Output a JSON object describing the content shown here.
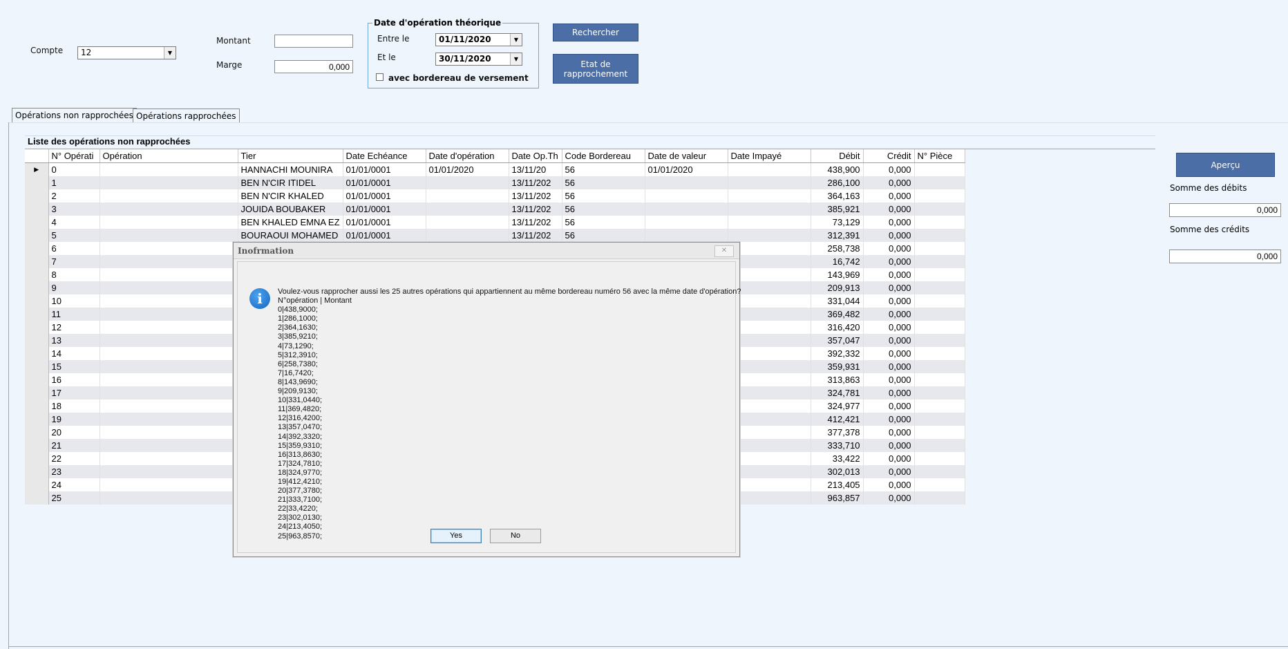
{
  "filters": {
    "compte_label": "Compte",
    "compte_value": "12",
    "montant_label": "Montant",
    "montant_value": "",
    "marge_label": "Marge",
    "marge_value": "0,000",
    "date_group_title": "Date d'opération théorique",
    "entre_label": "Entre le",
    "entre_value": "01/11/2020",
    "et_label": "Et le",
    "et_value": "30/11/2020",
    "bordereau_checkbox_label": "avec bordereau de versement",
    "bordereau_checked": false
  },
  "buttons": {
    "rechercher": "Rechercher",
    "etat_line1": "Etat de",
    "etat_line2": "rapprochement",
    "apercu": "Aperçu"
  },
  "tabs": [
    {
      "label": "Opérations non rapprochées",
      "active": true
    },
    {
      "label": "Opérations rapprochées",
      "active": false
    }
  ],
  "list_title": "Liste des opérations non rapprochées",
  "columns": [
    "N° Opérati",
    "Opération",
    "Tier",
    "Date Echéance",
    "Date d'opération",
    "Date Op.Th",
    "Code Bordereau",
    "Date de valeur",
    "Date Impayé",
    "Débit",
    "Crédit",
    "N° Pièce"
  ],
  "rows": [
    [
      "0",
      "",
      "HANNACHI MOUNIRA",
      "01/01/0001",
      "01/01/2020",
      "13/11/20",
      "56",
      "01/01/2020",
      "",
      "438,900",
      "0,000",
      ""
    ],
    [
      "1",
      "",
      "BEN N'CIR ITIDEL",
      "01/01/0001",
      "",
      "13/11/202",
      "56",
      "",
      "",
      "286,100",
      "0,000",
      ""
    ],
    [
      "2",
      "",
      "BEN N'CIR KHALED",
      "01/01/0001",
      "",
      "13/11/202",
      "56",
      "",
      "",
      "364,163",
      "0,000",
      ""
    ],
    [
      "3",
      "",
      "JOUIDA BOUBAKER",
      "01/01/0001",
      "",
      "13/11/202",
      "56",
      "",
      "",
      "385,921",
      "0,000",
      ""
    ],
    [
      "4",
      "",
      "BEN KHALED EMNA EZ",
      "01/01/0001",
      "",
      "13/11/202",
      "56",
      "",
      "",
      "73,129",
      "0,000",
      ""
    ],
    [
      "5",
      "",
      "BOURAOUI MOHAMED",
      "01/01/0001",
      "",
      "13/11/202",
      "56",
      "",
      "",
      "312,391",
      "0,000",
      ""
    ],
    [
      "6",
      "",
      "",
      "",
      "",
      "",
      "",
      "",
      "",
      "258,738",
      "0,000",
      ""
    ],
    [
      "7",
      "",
      "",
      "",
      "",
      "",
      "",
      "",
      "",
      "16,742",
      "0,000",
      ""
    ],
    [
      "8",
      "",
      "",
      "",
      "",
      "",
      "",
      "",
      "",
      "143,969",
      "0,000",
      ""
    ],
    [
      "9",
      "",
      "",
      "",
      "",
      "",
      "",
      "",
      "",
      "209,913",
      "0,000",
      ""
    ],
    [
      "10",
      "",
      "",
      "",
      "",
      "",
      "",
      "",
      "",
      "331,044",
      "0,000",
      ""
    ],
    [
      "11",
      "",
      "",
      "",
      "",
      "",
      "",
      "",
      "",
      "369,482",
      "0,000",
      ""
    ],
    [
      "12",
      "",
      "",
      "",
      "",
      "",
      "",
      "",
      "",
      "316,420",
      "0,000",
      ""
    ],
    [
      "13",
      "",
      "",
      "",
      "",
      "",
      "",
      "",
      "",
      "357,047",
      "0,000",
      ""
    ],
    [
      "14",
      "",
      "",
      "",
      "",
      "",
      "",
      "",
      "",
      "392,332",
      "0,000",
      ""
    ],
    [
      "15",
      "",
      "",
      "",
      "",
      "",
      "",
      "",
      "",
      "359,931",
      "0,000",
      ""
    ],
    [
      "16",
      "",
      "",
      "",
      "",
      "",
      "",
      "",
      "",
      "313,863",
      "0,000",
      ""
    ],
    [
      "17",
      "",
      "",
      "",
      "",
      "",
      "",
      "",
      "",
      "324,781",
      "0,000",
      ""
    ],
    [
      "18",
      "",
      "",
      "",
      "",
      "",
      "",
      "",
      "",
      "324,977",
      "0,000",
      ""
    ],
    [
      "19",
      "",
      "",
      "",
      "",
      "",
      "",
      "",
      "",
      "412,421",
      "0,000",
      ""
    ],
    [
      "20",
      "",
      "",
      "",
      "",
      "",
      "",
      "",
      "",
      "377,378",
      "0,000",
      ""
    ],
    [
      "21",
      "",
      "",
      "",
      "",
      "",
      "",
      "",
      "",
      "333,710",
      "0,000",
      ""
    ],
    [
      "22",
      "",
      "",
      "",
      "",
      "",
      "",
      "",
      "",
      "33,422",
      "0,000",
      ""
    ],
    [
      "23",
      "",
      "",
      "",
      "",
      "",
      "",
      "",
      "",
      "302,013",
      "0,000",
      ""
    ],
    [
      "24",
      "",
      "",
      "",
      "",
      "",
      "",
      "",
      "",
      "213,405",
      "0,000",
      ""
    ],
    [
      "25",
      "",
      "",
      "",
      "",
      "",
      "",
      "",
      "",
      "963,857",
      "0,000",
      ""
    ]
  ],
  "summary": {
    "debits_label": "Somme des débits",
    "debits_value": "0,000",
    "credits_label": "Somme des crédits",
    "credits_value": "0,000"
  },
  "dialog": {
    "title": "Inofrmation",
    "close_glyph": "✕",
    "icon_glyph": "i",
    "message": "Voulez-vous rapprocher aussi les 25 autres opérations qui appartiennent au même bordereau numéro 56 avec la même date d'opération?\nN°opération | Montant\n0|438,9000;\n1|286,1000;\n2|364,1630;\n3|385,9210;\n4|73,1290;\n5|312,3910;\n6|258,7380;\n7|16,7420;\n8|143,9690;\n9|209,9130;\n10|331,0440;\n11|369,4820;\n12|316,4200;\n13|357,0470;\n14|392,3320;\n15|359,9310;\n16|313,8630;\n17|324,7810;\n18|324,9770;\n19|412,4210;\n20|377,3780;\n21|333,7100;\n22|33,4220;\n23|302,0130;\n24|213,4050;\n25|963,8570;",
    "yes_label": "Yes",
    "no_label": "No"
  }
}
